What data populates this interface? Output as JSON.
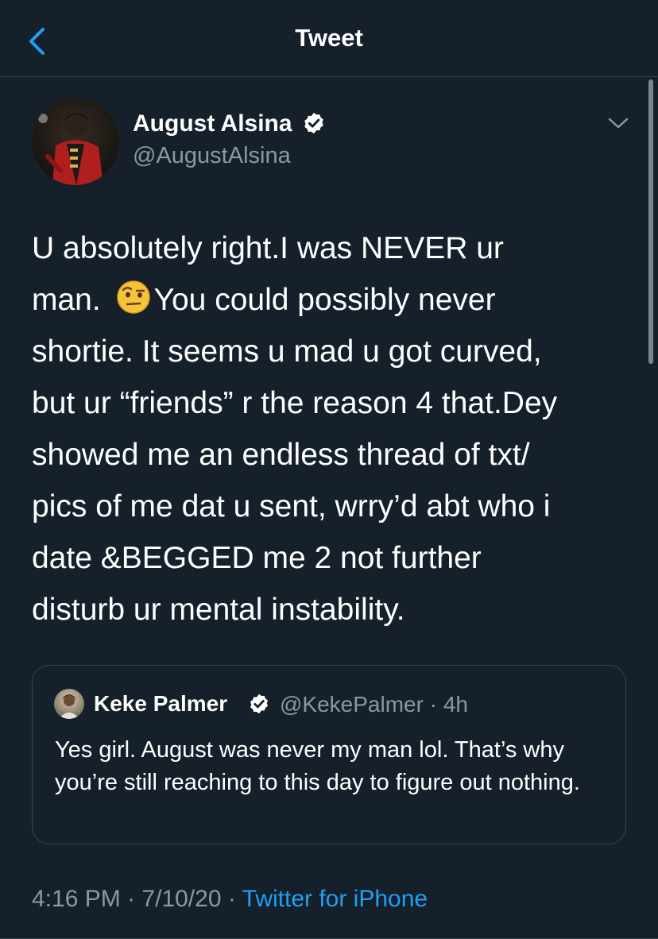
{
  "header": {
    "title": "Tweet",
    "back_icon": "chevron-left-icon",
    "accent": "#1da1f2"
  },
  "tweet": {
    "author": {
      "name": "August Alsina",
      "handle": "@AugustAlsina",
      "verified": true
    },
    "text_before_emoji": "U absolutely right.I was NEVER ur\nman. ",
    "emoji": "face-with-raised-eyebrow-emoji",
    "text_after_emoji": "You could possibly never\nshortie. It seems u mad u got curved,\nbut ur “friends” r the reason 4 that.Dey\nshowed me an endless thread of txt/\npics of me dat u sent, wrry’d abt who i\ndate &BEGGED me 2 not further\ndisturb ur mental instability.",
    "quoted": {
      "name": "Keke Palmer",
      "handle": "@KekePalmer",
      "time": "4h",
      "text": "Yes girl. August was never my man lol. That’s why you’re still reaching to this day to figure out nothing."
    },
    "time": "4:16 PM",
    "date": "7/10/20",
    "separator": "·",
    "source": "Twitter for iPhone"
  },
  "colors": {
    "background": "#15202b",
    "secondary_text": "#8899a6",
    "border": "#38444d",
    "link": "#1da1f2"
  }
}
